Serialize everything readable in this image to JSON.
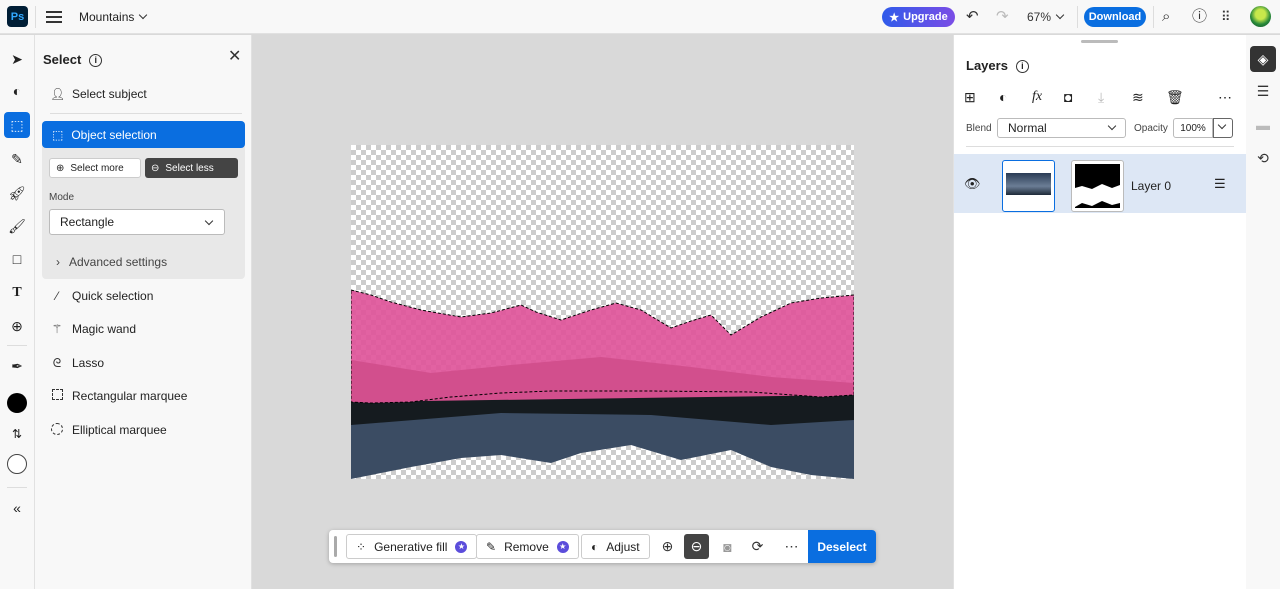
{
  "app": {
    "logo": "Ps",
    "doc_title": "Mountains"
  },
  "header": {
    "upgrade_label": "Upgrade",
    "zoom_level": "67%",
    "download_label": "Download",
    "icons": [
      "menu-icon",
      "undo-icon",
      "redo-icon",
      "search-icon",
      "help-icon",
      "apps-icon",
      "avatar"
    ]
  },
  "toolbar": {
    "tools": [
      "move",
      "adjust",
      "object-selection",
      "healing",
      "quick-actions",
      "brush",
      "rectangle",
      "type",
      "add-image",
      "eyedropper",
      "foreground-color",
      "swap-colors",
      "background-color",
      "collapse"
    ],
    "active": "object-selection",
    "foreground_color": "#000000",
    "background_color": "#ffffff"
  },
  "select_panel": {
    "title": "Select",
    "items": [
      {
        "label": "Select subject"
      },
      {
        "label": "Object selection"
      },
      {
        "label": "Quick selection"
      },
      {
        "label": "Magic wand"
      },
      {
        "label": "Lasso"
      },
      {
        "label": "Rectangular marquee"
      },
      {
        "label": "Elliptical marquee"
      }
    ],
    "select_more": "Select more",
    "select_less": "Select less",
    "mode_label": "Mode",
    "mode_value": "Rectangle",
    "advanced_settings": "Advanced settings"
  },
  "taskbar": {
    "generative_fill": "Generative fill",
    "remove": "Remove",
    "adjust": "Adjust",
    "deselect": "Deselect"
  },
  "layers_panel": {
    "title": "Layers",
    "blend_label": "Blend",
    "blend_value": "Normal",
    "opacity_label": "Opacity",
    "opacity_value": "100%",
    "layers": [
      {
        "name": "Layer 0",
        "visible": true
      }
    ]
  },
  "colors": {
    "accent": "#0a6ee0",
    "selection_overlay": "#e0559a"
  }
}
